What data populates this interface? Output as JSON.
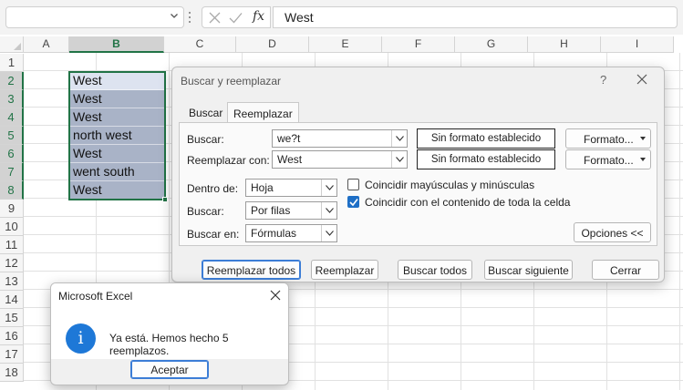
{
  "formula_bar": {
    "cancel_icon": "x-icon",
    "enter_icon": "check-icon",
    "fx_label": "fx",
    "value": "West"
  },
  "sheet": {
    "columns": [
      "A",
      "B",
      "C",
      "D",
      "E",
      "F",
      "G",
      "H",
      "I"
    ],
    "rows": [
      "1",
      "2",
      "3",
      "4",
      "5",
      "6",
      "7",
      "8",
      "9",
      "10",
      "11",
      "12",
      "13",
      "14",
      "15",
      "16",
      "17",
      "18"
    ],
    "selected_column": "B",
    "cells_b": [
      "West",
      "West",
      "West",
      "north west",
      "West",
      "went south",
      "West"
    ],
    "selection_colors": {
      "active": "#dde3f0",
      "range": "#a9b3c7",
      "border": "#217346"
    }
  },
  "find_replace": {
    "title": "Buscar y reemplazar",
    "help": "?",
    "tabs": [
      "Buscar",
      "Reemplazar"
    ],
    "active_tab": "Reemplazar",
    "find_label": "Buscar:",
    "find_value": "we?t",
    "replace_label": "Reemplazar con:",
    "replace_value": "West",
    "format_none_1": "Sin formato establecido",
    "format_none_2": "Sin formato establecido",
    "format_btn_1": "Formato...",
    "format_btn_2": "Formato...",
    "within_label": "Dentro de:",
    "within_value": "Hoja",
    "search_label": "Buscar:",
    "search_value": "Por filas",
    "look_in_label": "Buscar en:",
    "look_in_value": "Fórmulas",
    "match_case_label": "Coincidir mayúsculas y minúsculas",
    "match_case_checked": false,
    "match_entire_label": "Coincidir con el contenido de toda la celda",
    "match_entire_checked": true,
    "options_btn": "Opciones <<",
    "replace_all_btn": "Reemplazar todos",
    "replace_btn": "Reemplazar",
    "find_all_btn": "Buscar todos",
    "find_next_btn": "Buscar siguiente",
    "close_btn": "Cerrar"
  },
  "message_box": {
    "title": "Microsoft Excel",
    "icon": "info-icon",
    "icon_glyph": "i",
    "text": "Ya está. Hemos hecho 5 reemplazos.",
    "ok_btn": "Aceptar"
  }
}
